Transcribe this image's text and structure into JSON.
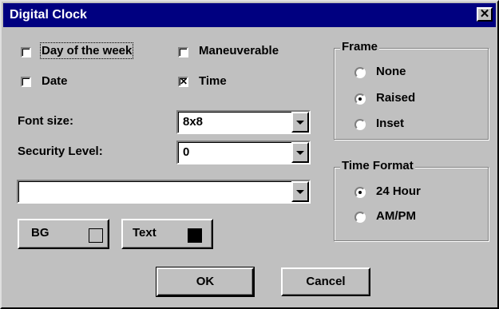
{
  "window": {
    "title": "Digital Clock",
    "close_glyph": "✕"
  },
  "options": {
    "day_of_week": {
      "label": "Day of the week",
      "underline": "D",
      "checked": false
    },
    "maneuverable": {
      "label": "Maneuverable",
      "underline": "M",
      "checked": false
    },
    "date": {
      "label": "Date",
      "underline": "D",
      "checked": false
    },
    "time": {
      "label": "Time",
      "underline": "T",
      "checked": true
    }
  },
  "font_size": {
    "label": "Font size:",
    "value": "8x8"
  },
  "security_level": {
    "label": "Security Level:",
    "value": "0"
  },
  "extra_combo": {
    "value": ""
  },
  "colors": {
    "bg": {
      "label": "BG",
      "swatch": "#c0c0c0"
    },
    "text": {
      "label": "Text",
      "swatch": "#000000"
    }
  },
  "frame": {
    "title": "Frame",
    "options": [
      {
        "label": "None",
        "selected": false
      },
      {
        "label": "Raised",
        "selected": true
      },
      {
        "label": "Inset",
        "selected": false
      }
    ]
  },
  "time_format": {
    "title": "Time Format",
    "options": [
      {
        "label": "24 Hour",
        "selected": true
      },
      {
        "label": "AM/PM",
        "selected": false
      }
    ]
  },
  "buttons": {
    "ok": "OK",
    "cancel": "Cancel"
  },
  "colors_theme": {
    "face": "#c0c0c0",
    "titlebar": "#000080"
  }
}
